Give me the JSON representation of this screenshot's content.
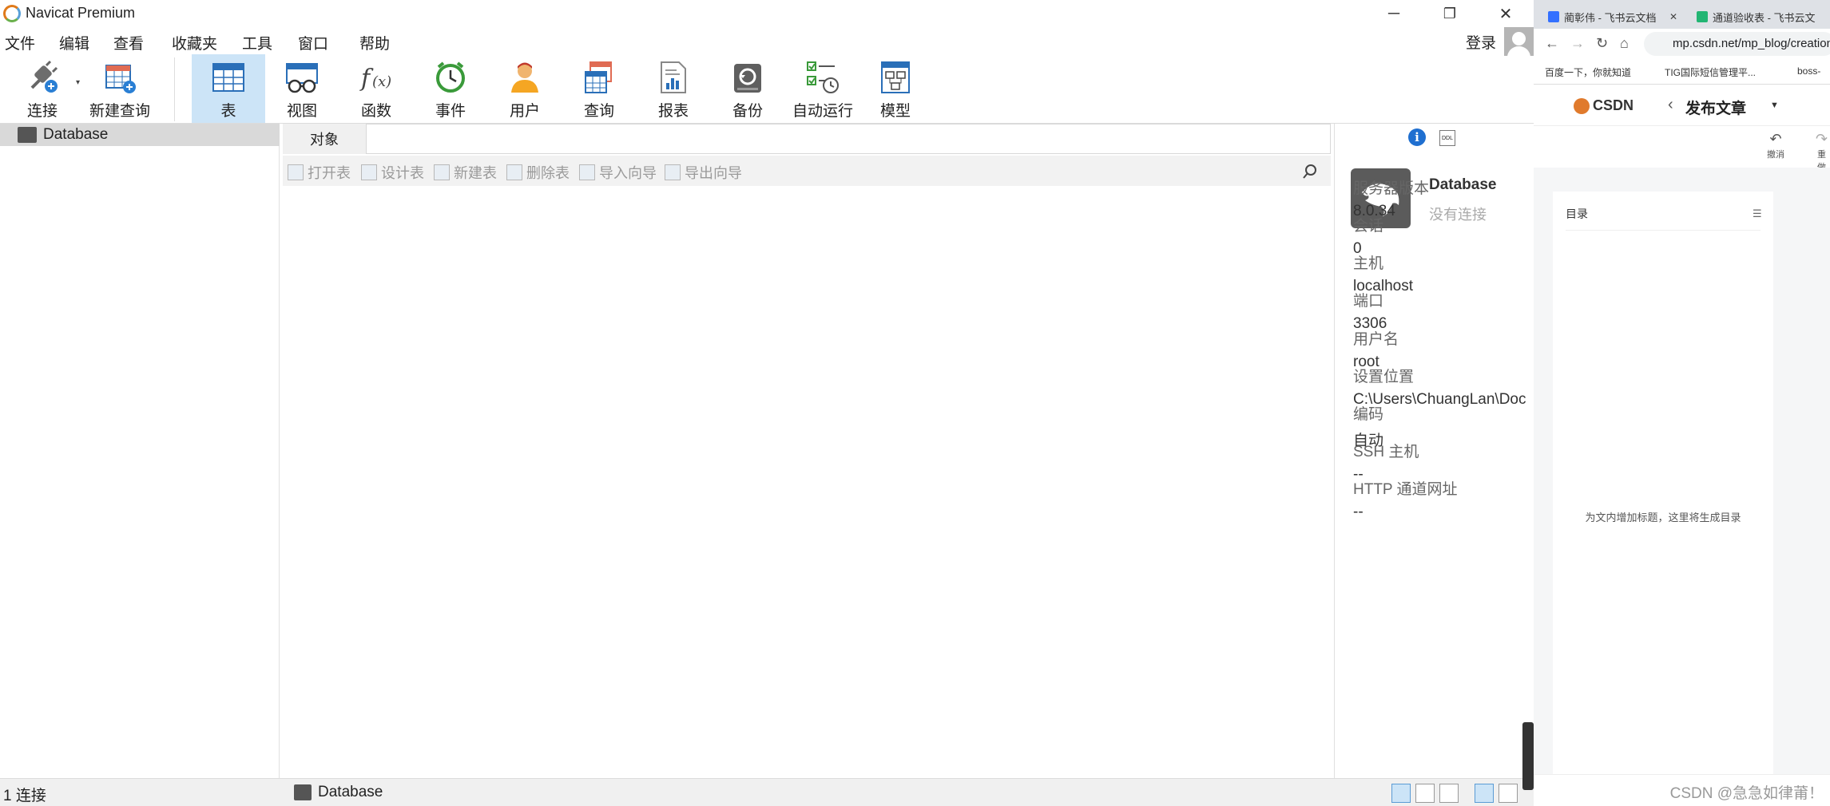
{
  "window": {
    "title": "Navicat Premium",
    "minimize": "─",
    "maximize": "❐",
    "close": "✕"
  },
  "menu": [
    "文件",
    "编辑",
    "查看",
    "收藏夹",
    "工具",
    "窗口",
    "帮助"
  ],
  "account": {
    "login_label": "登录"
  },
  "toolbar": {
    "connect": "连接",
    "new_query": "新建查询",
    "table": "表",
    "view": "视图",
    "function": "函数",
    "event": "事件",
    "user": "用户",
    "query": "查询",
    "report": "报表",
    "backup": "备份",
    "automation": "自动运行",
    "model": "模型"
  },
  "tree": {
    "items": [
      {
        "label": "Database",
        "selected": true
      }
    ]
  },
  "tabs": {
    "objects": "对象"
  },
  "object_toolbar": {
    "open_table": "打开表",
    "design_table": "设计表",
    "new_table": "新建表",
    "delete_table": "删除表",
    "import_wizard": "导入向导",
    "export_wizard": "导出向导"
  },
  "info_panel": {
    "info_icon": "i",
    "ddl_icon": "DDL",
    "db_name": "Database",
    "connection_status": "没有连接",
    "fields": [
      {
        "label": "服务器版本",
        "value": "8.0.34"
      },
      {
        "label": "会话",
        "value": "0"
      },
      {
        "label": "主机",
        "value": "localhost"
      },
      {
        "label": "端口",
        "value": "3306"
      },
      {
        "label": "用户名",
        "value": "root"
      },
      {
        "label": "设置位置",
        "value": "C:\\Users\\ChuangLan\\Documents"
      },
      {
        "label": "编码",
        "value": "自动"
      },
      {
        "label": "SSH 主机",
        "value": "--"
      },
      {
        "label": "HTTP 通道网址",
        "value": "--"
      }
    ]
  },
  "status": {
    "connections": "1 连接",
    "current": "Database"
  },
  "browser": {
    "tabs": [
      {
        "label": "蔺彰伟 - 飞书云文档",
        "favicon_color": "#3370ff"
      },
      {
        "label": "通道验收表 - 飞书云文",
        "favicon_color": "#22b573"
      }
    ],
    "tab_close": "✕",
    "url": "mp.csdn.net/mp_blog/creation",
    "bookmarks": [
      "百度一下，你就知道",
      "TIG国际短信管理平...",
      "boss-"
    ],
    "csdn_logo": "CSDN",
    "page_title": "发布文章",
    "undo": "撤消",
    "redo": "重做",
    "toc_title": "目录",
    "toc_empty": "为文内增加标题，这里将生成目录",
    "footer": "CSDN @急急如律莆！"
  }
}
